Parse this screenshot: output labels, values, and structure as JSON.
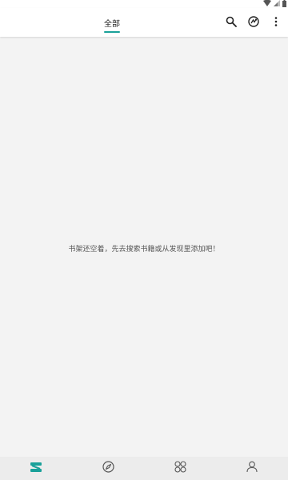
{
  "header": {
    "tab_all_label": "全部"
  },
  "header_actions": [
    {
      "icon": "search-icon"
    },
    {
      "icon": "sync-icon"
    },
    {
      "icon": "more-vertical-icon"
    }
  ],
  "content": {
    "empty_message": "书架还空着，先去搜索书籍或从发现里添加吧！"
  },
  "bottom_nav": [
    {
      "icon": "bookshelf-icon",
      "active": true
    },
    {
      "icon": "compass-icon",
      "active": false
    },
    {
      "icon": "grid-apps-icon",
      "active": false
    },
    {
      "icon": "person-icon",
      "active": false
    }
  ],
  "colors": {
    "accent": "#1aa19a",
    "icon_default": "#555555",
    "background": "#f3f3f3",
    "bottom_nav_bg": "#ececec"
  }
}
